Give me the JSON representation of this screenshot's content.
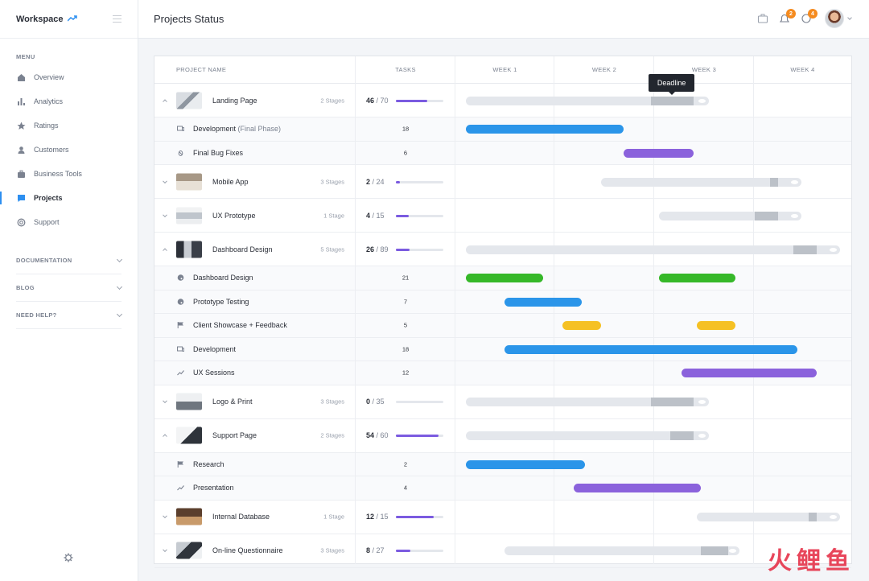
{
  "app": {
    "brand": "Workspace",
    "page_title": "Projects Status"
  },
  "colors": {
    "accent": "#2d8ff0",
    "blue": "#2b95e9",
    "purple": "#8b62dc",
    "green": "#36b829",
    "yellow": "#f5c124",
    "badge": "#f58b1f"
  },
  "sidebar": {
    "menu_heading": "MENU",
    "items": [
      {
        "label": "Overview",
        "icon": "home-icon"
      },
      {
        "label": "Analytics",
        "icon": "bar-chart-icon"
      },
      {
        "label": "Ratings",
        "icon": "star-icon"
      },
      {
        "label": "Customers",
        "icon": "users-icon"
      },
      {
        "label": "Business Tools",
        "icon": "briefcase-icon"
      },
      {
        "label": "Projects",
        "icon": "chat-icon",
        "active": true
      },
      {
        "label": "Support",
        "icon": "lifebuoy-icon"
      }
    ],
    "sections": [
      "DOCUMENTATION",
      "BLOG",
      "NEED HELP?"
    ]
  },
  "topbar": {
    "notifications_count": "2",
    "messages_count": "4"
  },
  "table": {
    "headers": {
      "project": "PROJECT NAME",
      "tasks": "TASKS",
      "weeks": [
        "WEEK 1",
        "WEEK 2",
        "WEEK 3",
        "WEEK 4"
      ]
    },
    "tooltip": "Deadline",
    "rows": [
      {
        "type": "project",
        "name": "Landing Page",
        "stages": "2 Stages",
        "done": "46",
        "total": "70",
        "expanded": true,
        "progress": 0.66,
        "timeline": [
          0.0,
          0.63
        ],
        "deadline": [
          0.48,
          0.59
        ]
      },
      {
        "type": "task",
        "name": "Development",
        "paren": " (Final Phase)",
        "icon": "device-icon",
        "count": "18",
        "color": "blue",
        "timeline": [
          0.0,
          0.41
        ]
      },
      {
        "type": "task",
        "name": "Final Bug Fixes",
        "icon": "bug-icon",
        "count": "6",
        "color": "purple",
        "timeline": [
          0.41,
          0.59
        ]
      },
      {
        "type": "project",
        "name": "Mobile App",
        "stages": "3 Stages",
        "done": "2",
        "total": "24",
        "expanded": false,
        "progress": 0.08,
        "timeline": [
          0.35,
          0.87
        ],
        "deadline": [
          0.79,
          0.81
        ]
      },
      {
        "type": "project",
        "name": "UX Prototype",
        "stages": "1 Stage",
        "done": "4",
        "total": "15",
        "expanded": false,
        "progress": 0.27,
        "timeline": [
          0.5,
          0.87
        ],
        "deadline": [
          0.75,
          0.81
        ]
      },
      {
        "type": "project",
        "name": "Dashboard Design",
        "stages": "5 Stages",
        "done": "26",
        "total": "89",
        "expanded": true,
        "progress": 0.29,
        "timeline": [
          0.0,
          0.97
        ],
        "deadline": [
          0.85,
          0.91
        ]
      },
      {
        "type": "task",
        "name": "Dashboard Design",
        "icon": "palette-icon",
        "count": "21",
        "color": "green",
        "timeline": [
          0.0,
          0.2
        ],
        "timeline2": [
          0.5,
          0.7
        ]
      },
      {
        "type": "task",
        "name": "Prototype Testing",
        "icon": "palette-icon",
        "count": "7",
        "color": "blue",
        "timeline": [
          0.1,
          0.3
        ]
      },
      {
        "type": "task",
        "name": "Client Showcase + Feedback",
        "icon": "flag-icon",
        "count": "5",
        "color": "yellow",
        "timeline": [
          0.25,
          0.35
        ],
        "timeline2": [
          0.6,
          0.7
        ]
      },
      {
        "type": "task",
        "name": "Development",
        "icon": "device-icon",
        "count": "18",
        "color": "blue",
        "timeline": [
          0.1,
          0.86
        ]
      },
      {
        "type": "task",
        "name": "UX Sessions",
        "icon": "trend-icon",
        "count": "12",
        "color": "purple",
        "timeline": [
          0.56,
          0.91
        ]
      },
      {
        "type": "project",
        "name": "Logo & Print",
        "stages": "3 Stages",
        "done": "0",
        "total": "35",
        "expanded": false,
        "progress": 0.0,
        "timeline": [
          0.0,
          0.63
        ],
        "deadline": [
          0.48,
          0.59
        ]
      },
      {
        "type": "project",
        "name": "Support Page",
        "stages": "2 Stages",
        "done": "54",
        "total": "60",
        "expanded": true,
        "progress": 0.9,
        "timeline": [
          0.0,
          0.63
        ],
        "deadline": [
          0.53,
          0.59
        ]
      },
      {
        "type": "task",
        "name": "Research",
        "icon": "flag-icon",
        "count": "2",
        "color": "blue",
        "timeline": [
          0.0,
          0.31
        ]
      },
      {
        "type": "task",
        "name": "Presentation",
        "icon": "trend-icon",
        "count": "4",
        "color": "purple",
        "timeline": [
          0.28,
          0.61
        ]
      },
      {
        "type": "project",
        "name": "Internal Database",
        "stages": "1 Stage",
        "done": "12",
        "total": "15",
        "expanded": false,
        "progress": 0.8,
        "timeline": [
          0.6,
          0.97
        ],
        "deadline": [
          0.89,
          0.91
        ]
      },
      {
        "type": "project",
        "name": "On-line Questionnaire",
        "stages": "3 Stages",
        "done": "8",
        "total": "27",
        "expanded": false,
        "progress": 0.3,
        "timeline": [
          0.1,
          0.71
        ],
        "deadline": [
          0.61,
          0.68
        ]
      }
    ]
  },
  "watermark": "火鲤鱼"
}
